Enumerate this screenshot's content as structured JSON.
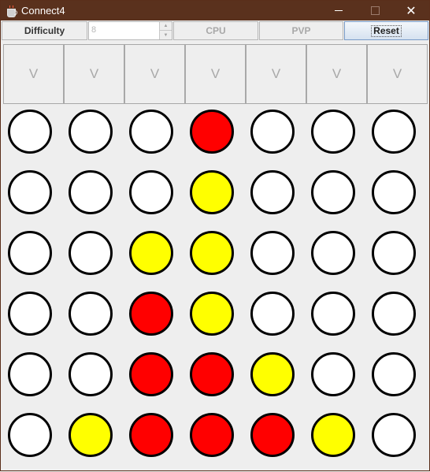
{
  "window": {
    "title": "Connect4",
    "controls": {
      "minimize": "—",
      "maximize": "☐",
      "close": "✕"
    }
  },
  "toolbar": {
    "difficulty_label": "Difficulty",
    "difficulty_value": "8",
    "cpu_label": "CPU",
    "pvp_label": "PVP",
    "reset_label": "Reset"
  },
  "columns": [
    {
      "label": "V"
    },
    {
      "label": "V"
    },
    {
      "label": "V"
    },
    {
      "label": "V"
    },
    {
      "label": "V"
    },
    {
      "label": "V"
    },
    {
      "label": "V"
    }
  ],
  "colors": {
    "red": "#FF0000",
    "yellow": "#FFFF00",
    "empty": "#FFFFFF",
    "titlebar": "#5A311D"
  },
  "board": [
    [
      "empty",
      "empty",
      "empty",
      "red",
      "empty",
      "empty",
      "empty"
    ],
    [
      "empty",
      "empty",
      "empty",
      "yellow",
      "empty",
      "empty",
      "empty"
    ],
    [
      "empty",
      "empty",
      "yellow",
      "yellow",
      "empty",
      "empty",
      "empty"
    ],
    [
      "empty",
      "empty",
      "red",
      "yellow",
      "empty",
      "empty",
      "empty"
    ],
    [
      "empty",
      "empty",
      "red",
      "red",
      "yellow",
      "empty",
      "empty"
    ],
    [
      "empty",
      "yellow",
      "red",
      "red",
      "red",
      "yellow",
      "empty"
    ]
  ]
}
